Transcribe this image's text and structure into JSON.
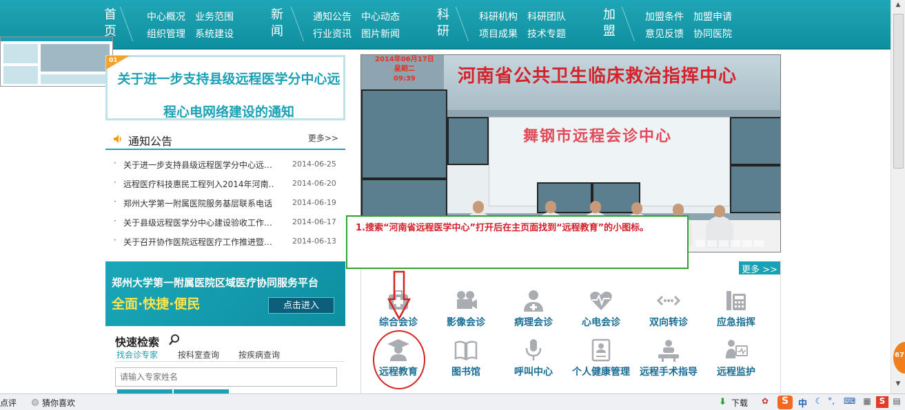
{
  "nav": {
    "groups": [
      {
        "head": "首页",
        "links": [
          "中心概况",
          "业务范围",
          "组织管理",
          "系统建设"
        ]
      },
      {
        "head": "新闻",
        "links": [
          "通知公告",
          "中心动态",
          "行业资讯",
          "图片新闻"
        ]
      },
      {
        "head": "科研",
        "links": [
          "科研机构",
          "科研团队",
          "项目成果",
          "技术专题"
        ]
      },
      {
        "head": "加盟",
        "links": [
          "加盟条件",
          "加盟申请",
          "意见反馈",
          "协同医院"
        ]
      }
    ]
  },
  "headline": {
    "text": "关于进一步支持县级远程医学分中心远程心电网络建设的通知",
    "badge": "01"
  },
  "notice": {
    "title": "通知公告",
    "more": "更多>>",
    "items": [
      {
        "text": "关于进一步支持县级远程医学分中心远…",
        "date": "2014-06-25"
      },
      {
        "text": "远程医疗科技惠民工程列入2014年河南…",
        "date": "2014-06-20"
      },
      {
        "text": "郑州大学第一附属医院服务基层联系电话",
        "date": "2014-06-19"
      },
      {
        "text": "关于县级远程医学分中心建设验收工作…",
        "date": "2014-06-17"
      },
      {
        "text": "关于召开协作医院远程医疗工作推进暨…",
        "date": "2014-06-13"
      }
    ]
  },
  "banner": {
    "line1": "郑州大学第一附属医院区域医疗协同服务平台",
    "line2": "全面·快捷·便民",
    "button": "点击进入"
  },
  "quick_search": {
    "title": "快速检索",
    "tabs": [
      "找会诊专家",
      "按科室查询",
      "按疾病查询"
    ],
    "placeholder": "请输入专家姓名"
  },
  "photo": {
    "date": "2014年06月17日",
    "weekday": "星期二",
    "time": "09:39",
    "sign": "河南省公共卫生临床救治指挥中心",
    "screen_text": "舞钢市远程会诊中心"
  },
  "services": {
    "more": "更多 >>",
    "row1": [
      {
        "label": "综合会诊",
        "icon": "medical-kit-icon"
      },
      {
        "label": "影像会诊",
        "icon": "video-camera-icon"
      },
      {
        "label": "病理会诊",
        "icon": "doctor-icon"
      },
      {
        "label": "心电会诊",
        "icon": "heartbeat-icon"
      },
      {
        "label": "双向转诊",
        "icon": "two-way-arrow-icon"
      },
      {
        "label": "应急指挥",
        "icon": "command-console-icon"
      }
    ],
    "row2": [
      {
        "label": "远程教育",
        "icon": "graduate-icon"
      },
      {
        "label": "图书馆",
        "icon": "open-book-icon"
      },
      {
        "label": "呼叫中心",
        "icon": "microphone-icon"
      },
      {
        "label": "个人健康管理",
        "icon": "id-card-icon"
      },
      {
        "label": "远程手术指导",
        "icon": "surgeon-icon"
      },
      {
        "label": "远程监护",
        "icon": "monitor-nurse-icon"
      }
    ]
  },
  "annotation": {
    "text": "1.搜索“河南省远程医学中心”打开后在主页面找到“远程教育”的小图标。"
  },
  "float_badge": "67",
  "status_bar": {
    "left_text": "点评",
    "guess": "猜你喜欢",
    "download": "下载",
    "ime_mode": "中"
  },
  "colors": {
    "nav": "#1aa1b5",
    "service_label": "#1a6e94",
    "annotation_red": "#d41f2a",
    "annotation_green": "#2ea12e"
  }
}
